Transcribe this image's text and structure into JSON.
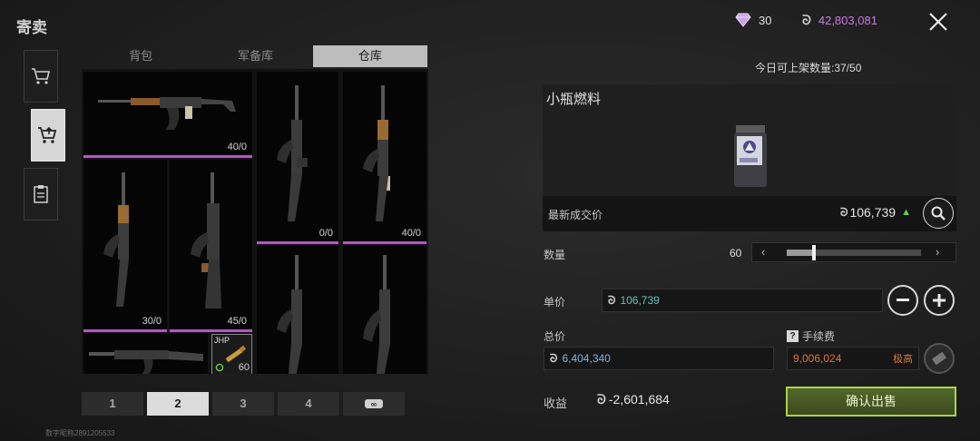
{
  "header": {
    "title": "寄卖",
    "gems": "30",
    "money": "42,803,081",
    "daily_listing": "今日可上架数量:37/50"
  },
  "left": {
    "tabs": [
      "背包",
      "军备库",
      "仓库"
    ],
    "active_tab": 2,
    "cells": [
      {
        "qty": "40/0",
        "icon": "ak-rifle-wood-icon"
      },
      {
        "qty": "0/0",
        "icon": "ak-rifle-black-icon"
      },
      {
        "qty": "40/0",
        "icon": "ak-rifle-wood-icon"
      },
      {
        "qty": "30/0",
        "icon": "ak-rifle-wood-icon"
      },
      {
        "qty": "45/0",
        "icon": "ak-rifle-tactical-icon"
      },
      {
        "qty": "",
        "icon": "ak-rifle-black-icon"
      },
      {
        "qty": "",
        "icon": "ak-rifle-black-icon"
      },
      {
        "qty": "",
        "icon": "ak-rifle-side-icon"
      },
      {
        "qty": "60",
        "label": "JHP",
        "icon": "ammo-jhp-icon"
      }
    ],
    "pages": [
      "1",
      "2",
      "3",
      "4"
    ],
    "active_page": 1,
    "watermark": "数字昵称2891205533"
  },
  "item": {
    "name": "小瓶燃料",
    "latest_label": "最新成交价",
    "latest_price": "106,739",
    "quantity_label": "数量",
    "quantity": "60",
    "quantity_fraction": 0.08,
    "unit_price_label": "单价",
    "unit_price": "106,739",
    "total_label": "总价",
    "total": "6,404,340",
    "fee_label": "手续费",
    "fee": "9,006,024",
    "fee_level": "极高",
    "profit_label": "收益",
    "profit": "-2,601,684",
    "confirm_label": "确认出售"
  },
  "colors": {
    "accent_purple": "#b556c8",
    "money_purple": "#c77be0",
    "unit_price_teal": "#5fc7c0",
    "total_blue": "#7fb5e0",
    "fee_orange": "#d8763a",
    "confirm_green": "#a8d64a"
  }
}
